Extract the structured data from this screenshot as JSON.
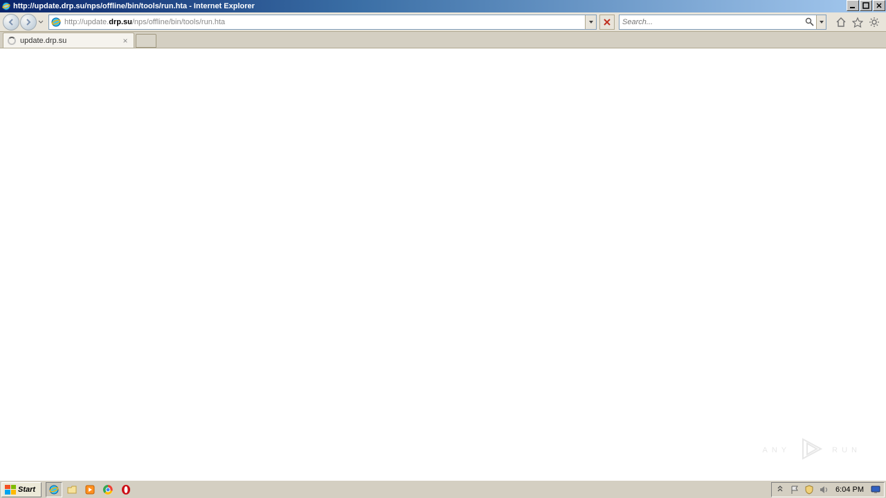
{
  "window": {
    "title": "http://update.drp.su/nps/offline/bin/tools/run.hta - Internet Explorer"
  },
  "toolbar": {
    "url_prefix": "http://update.",
    "url_host": "drp.su",
    "url_path": "/nps/offline/bin/tools/run.hta",
    "search_placeholder": "Search..."
  },
  "tabs": {
    "active_label": "update.drp.su"
  },
  "watermark": {
    "left": "ANY",
    "right": "RUN"
  },
  "taskbar": {
    "start_label": "Start",
    "clock": "6:04 PM"
  }
}
